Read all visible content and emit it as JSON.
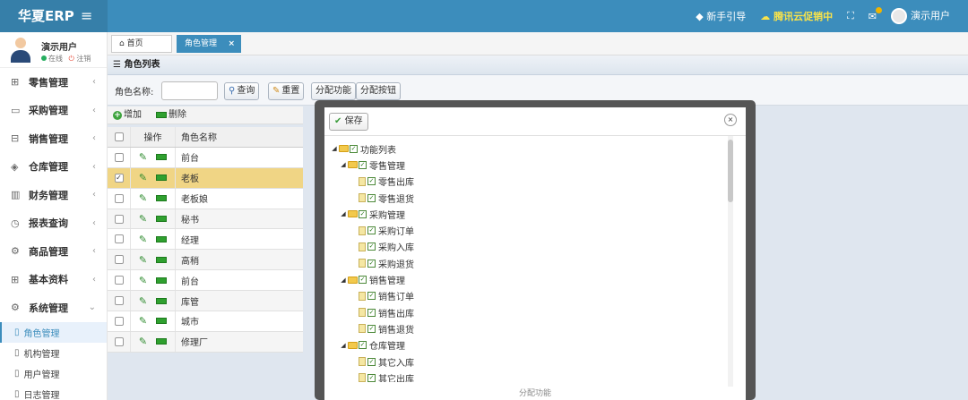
{
  "header": {
    "logo": "华夏ERP",
    "menu_icon": "≡",
    "guide": "新手引导",
    "promo": "腾讯云促销中",
    "user": "演示用户"
  },
  "sidebar": {
    "user_name": "演示用户",
    "status_online": "在线",
    "logout": "注销",
    "items": [
      {
        "label": "零售管理",
        "icon": "gift-icon"
      },
      {
        "label": "采购管理",
        "icon": "monitor-icon"
      },
      {
        "label": "销售管理",
        "icon": "briefcase-icon"
      },
      {
        "label": "仓库管理",
        "icon": "layers-icon"
      },
      {
        "label": "财务管理",
        "icon": "book-icon"
      },
      {
        "label": "报表查询",
        "icon": "clock-icon"
      },
      {
        "label": "商品管理",
        "icon": "box-icon"
      },
      {
        "label": "基本资料",
        "icon": "grid-icon"
      },
      {
        "label": "系统管理",
        "icon": "gear-icon"
      }
    ],
    "submenu": [
      {
        "label": "角色管理",
        "active": true
      },
      {
        "label": "机构管理",
        "active": false
      },
      {
        "label": "用户管理",
        "active": false
      },
      {
        "label": "日志管理",
        "active": false
      }
    ]
  },
  "tabs": {
    "home": "首页",
    "active": "角色管理",
    "close": "×"
  },
  "panel": {
    "title": "角色列表",
    "search_label": "角色名称:",
    "search_value": "",
    "btn_query": "查询",
    "btn_reset": "重置",
    "btn_assign_func": "分配功能",
    "btn_assign_btn": "分配按钮",
    "add": "增加",
    "delete": "删除"
  },
  "grid": {
    "col_op": "操作",
    "col_name": "角色名称",
    "rows": [
      {
        "name": "前台",
        "checked": false
      },
      {
        "name": "老板",
        "checked": true
      },
      {
        "name": "老板娘",
        "checked": false
      },
      {
        "name": "秘书",
        "checked": false
      },
      {
        "name": "经理",
        "checked": false
      },
      {
        "name": "高稍",
        "checked": false
      },
      {
        "name": "前台",
        "checked": false
      },
      {
        "name": "库管",
        "checked": false
      },
      {
        "name": "城市",
        "checked": false
      },
      {
        "name": "修理厂",
        "checked": false
      }
    ]
  },
  "modal": {
    "save": "保存",
    "close": "×",
    "footer": "分配功能",
    "tree": [
      {
        "label": "功能列表",
        "level": 0,
        "folder": true
      },
      {
        "label": "零售管理",
        "level": 1,
        "folder": true
      },
      {
        "label": "零售出库",
        "level": 2,
        "folder": false
      },
      {
        "label": "零售退货",
        "level": 2,
        "folder": false
      },
      {
        "label": "采购管理",
        "level": 1,
        "folder": true
      },
      {
        "label": "采购订单",
        "level": 2,
        "folder": false
      },
      {
        "label": "采购入库",
        "level": 2,
        "folder": false
      },
      {
        "label": "采购退货",
        "level": 2,
        "folder": false
      },
      {
        "label": "销售管理",
        "level": 1,
        "folder": true
      },
      {
        "label": "销售订单",
        "level": 2,
        "folder": false
      },
      {
        "label": "销售出库",
        "level": 2,
        "folder": false
      },
      {
        "label": "销售退货",
        "level": 2,
        "folder": false
      },
      {
        "label": "仓库管理",
        "level": 1,
        "folder": true
      },
      {
        "label": "其它入库",
        "level": 2,
        "folder": false
      },
      {
        "label": "其它出库",
        "level": 2,
        "folder": false
      }
    ]
  },
  "colors": {
    "primary": "#3c8dbc",
    "selected_row": "#f0d585",
    "promo": "#f9e34a"
  }
}
